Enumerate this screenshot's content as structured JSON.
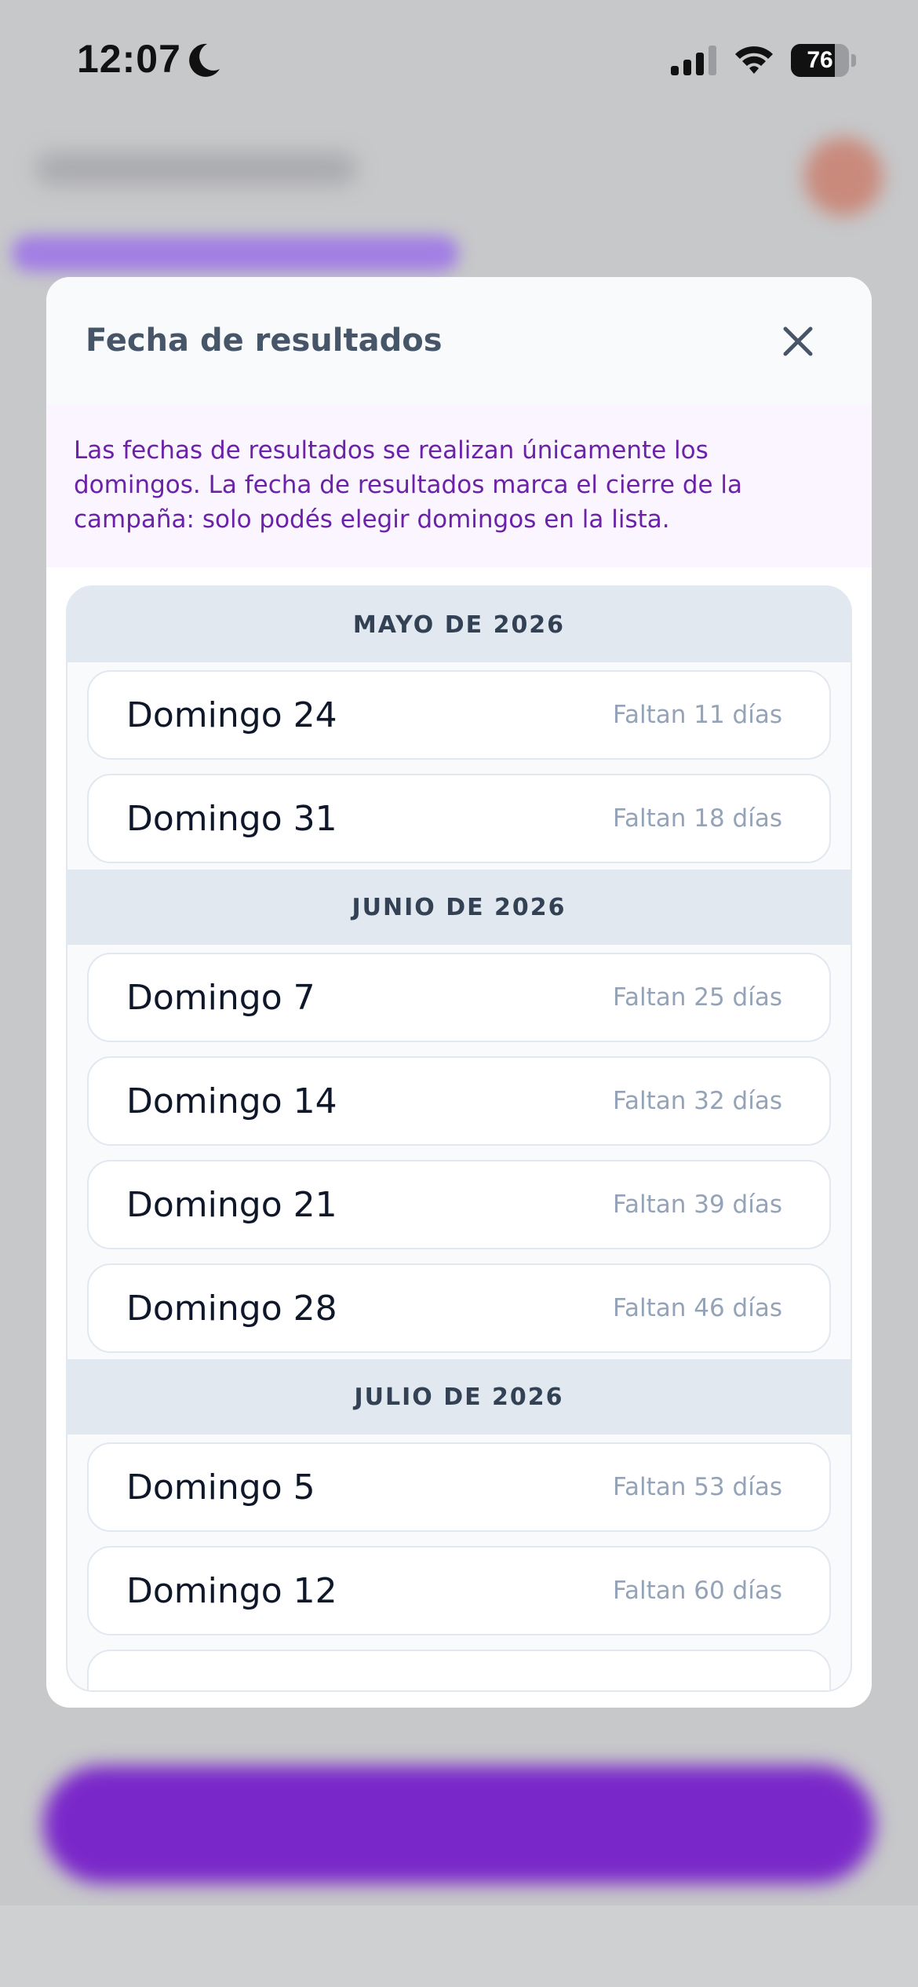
{
  "status_bar": {
    "time": "12:07",
    "battery_level": "76",
    "battery_fraction": 0.76,
    "icons": [
      "moon-icon",
      "signal-icon",
      "wifi-icon",
      "battery-icon"
    ]
  },
  "modal": {
    "title": "Fecha de resultados",
    "close_icon": "close-icon",
    "info_text": "Las fechas de resultados se realizan únicamente los domingos. La fecha de resultados marca el cierre de la campaña: solo podés elegir domingos en la lista.",
    "months": [
      {
        "label": "MAYO DE 2026",
        "days": [
          {
            "label": "Domingo 24",
            "remaining": "Faltan 11 días"
          },
          {
            "label": "Domingo 31",
            "remaining": "Faltan 18 días"
          }
        ]
      },
      {
        "label": "JUNIO DE 2026",
        "days": [
          {
            "label": "Domingo 7",
            "remaining": "Faltan 25 días"
          },
          {
            "label": "Domingo 14",
            "remaining": "Faltan 32 días"
          },
          {
            "label": "Domingo 21",
            "remaining": "Faltan 39 días"
          },
          {
            "label": "Domingo 28",
            "remaining": "Faltan 46 días"
          }
        ]
      },
      {
        "label": "JULIO DE 2026",
        "days": [
          {
            "label": "Domingo 5",
            "remaining": "Faltan 53 días"
          },
          {
            "label": "Domingo 12",
            "remaining": "Faltan 60 días"
          },
          {
            "label": "",
            "remaining": ""
          }
        ]
      }
    ]
  },
  "colors": {
    "accent": "#7a27c9",
    "info_text": "#6b21a8",
    "info_bg": "#faf5ff",
    "month_header_bg": "#e2e8f0"
  }
}
